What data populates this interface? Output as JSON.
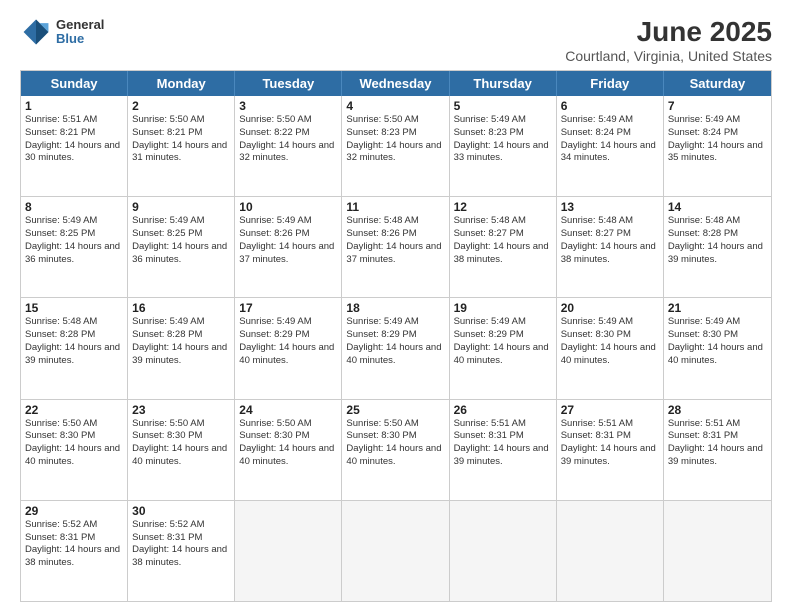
{
  "header": {
    "logo_general": "General",
    "logo_blue": "Blue",
    "title": "June 2025",
    "subtitle": "Courtland, Virginia, United States"
  },
  "weekdays": [
    "Sunday",
    "Monday",
    "Tuesday",
    "Wednesday",
    "Thursday",
    "Friday",
    "Saturday"
  ],
  "rows": [
    [
      {
        "day": "1",
        "sunrise": "Sunrise: 5:51 AM",
        "sunset": "Sunset: 8:21 PM",
        "daylight": "Daylight: 14 hours and 30 minutes."
      },
      {
        "day": "2",
        "sunrise": "Sunrise: 5:50 AM",
        "sunset": "Sunset: 8:21 PM",
        "daylight": "Daylight: 14 hours and 31 minutes."
      },
      {
        "day": "3",
        "sunrise": "Sunrise: 5:50 AM",
        "sunset": "Sunset: 8:22 PM",
        "daylight": "Daylight: 14 hours and 32 minutes."
      },
      {
        "day": "4",
        "sunrise": "Sunrise: 5:50 AM",
        "sunset": "Sunset: 8:23 PM",
        "daylight": "Daylight: 14 hours and 32 minutes."
      },
      {
        "day": "5",
        "sunrise": "Sunrise: 5:49 AM",
        "sunset": "Sunset: 8:23 PM",
        "daylight": "Daylight: 14 hours and 33 minutes."
      },
      {
        "day": "6",
        "sunrise": "Sunrise: 5:49 AM",
        "sunset": "Sunset: 8:24 PM",
        "daylight": "Daylight: 14 hours and 34 minutes."
      },
      {
        "day": "7",
        "sunrise": "Sunrise: 5:49 AM",
        "sunset": "Sunset: 8:24 PM",
        "daylight": "Daylight: 14 hours and 35 minutes."
      }
    ],
    [
      {
        "day": "8",
        "sunrise": "Sunrise: 5:49 AM",
        "sunset": "Sunset: 8:25 PM",
        "daylight": "Daylight: 14 hours and 36 minutes."
      },
      {
        "day": "9",
        "sunrise": "Sunrise: 5:49 AM",
        "sunset": "Sunset: 8:25 PM",
        "daylight": "Daylight: 14 hours and 36 minutes."
      },
      {
        "day": "10",
        "sunrise": "Sunrise: 5:49 AM",
        "sunset": "Sunset: 8:26 PM",
        "daylight": "Daylight: 14 hours and 37 minutes."
      },
      {
        "day": "11",
        "sunrise": "Sunrise: 5:48 AM",
        "sunset": "Sunset: 8:26 PM",
        "daylight": "Daylight: 14 hours and 37 minutes."
      },
      {
        "day": "12",
        "sunrise": "Sunrise: 5:48 AM",
        "sunset": "Sunset: 8:27 PM",
        "daylight": "Daylight: 14 hours and 38 minutes."
      },
      {
        "day": "13",
        "sunrise": "Sunrise: 5:48 AM",
        "sunset": "Sunset: 8:27 PM",
        "daylight": "Daylight: 14 hours and 38 minutes."
      },
      {
        "day": "14",
        "sunrise": "Sunrise: 5:48 AM",
        "sunset": "Sunset: 8:28 PM",
        "daylight": "Daylight: 14 hours and 39 minutes."
      }
    ],
    [
      {
        "day": "15",
        "sunrise": "Sunrise: 5:48 AM",
        "sunset": "Sunset: 8:28 PM",
        "daylight": "Daylight: 14 hours and 39 minutes."
      },
      {
        "day": "16",
        "sunrise": "Sunrise: 5:49 AM",
        "sunset": "Sunset: 8:28 PM",
        "daylight": "Daylight: 14 hours and 39 minutes."
      },
      {
        "day": "17",
        "sunrise": "Sunrise: 5:49 AM",
        "sunset": "Sunset: 8:29 PM",
        "daylight": "Daylight: 14 hours and 40 minutes."
      },
      {
        "day": "18",
        "sunrise": "Sunrise: 5:49 AM",
        "sunset": "Sunset: 8:29 PM",
        "daylight": "Daylight: 14 hours and 40 minutes."
      },
      {
        "day": "19",
        "sunrise": "Sunrise: 5:49 AM",
        "sunset": "Sunset: 8:29 PM",
        "daylight": "Daylight: 14 hours and 40 minutes."
      },
      {
        "day": "20",
        "sunrise": "Sunrise: 5:49 AM",
        "sunset": "Sunset: 8:30 PM",
        "daylight": "Daylight: 14 hours and 40 minutes."
      },
      {
        "day": "21",
        "sunrise": "Sunrise: 5:49 AM",
        "sunset": "Sunset: 8:30 PM",
        "daylight": "Daylight: 14 hours and 40 minutes."
      }
    ],
    [
      {
        "day": "22",
        "sunrise": "Sunrise: 5:50 AM",
        "sunset": "Sunset: 8:30 PM",
        "daylight": "Daylight: 14 hours and 40 minutes."
      },
      {
        "day": "23",
        "sunrise": "Sunrise: 5:50 AM",
        "sunset": "Sunset: 8:30 PM",
        "daylight": "Daylight: 14 hours and 40 minutes."
      },
      {
        "day": "24",
        "sunrise": "Sunrise: 5:50 AM",
        "sunset": "Sunset: 8:30 PM",
        "daylight": "Daylight: 14 hours and 40 minutes."
      },
      {
        "day": "25",
        "sunrise": "Sunrise: 5:50 AM",
        "sunset": "Sunset: 8:30 PM",
        "daylight": "Daylight: 14 hours and 40 minutes."
      },
      {
        "day": "26",
        "sunrise": "Sunrise: 5:51 AM",
        "sunset": "Sunset: 8:31 PM",
        "daylight": "Daylight: 14 hours and 39 minutes."
      },
      {
        "day": "27",
        "sunrise": "Sunrise: 5:51 AM",
        "sunset": "Sunset: 8:31 PM",
        "daylight": "Daylight: 14 hours and 39 minutes."
      },
      {
        "day": "28",
        "sunrise": "Sunrise: 5:51 AM",
        "sunset": "Sunset: 8:31 PM",
        "daylight": "Daylight: 14 hours and 39 minutes."
      }
    ],
    [
      {
        "day": "29",
        "sunrise": "Sunrise: 5:52 AM",
        "sunset": "Sunset: 8:31 PM",
        "daylight": "Daylight: 14 hours and 38 minutes."
      },
      {
        "day": "30",
        "sunrise": "Sunrise: 5:52 AM",
        "sunset": "Sunset: 8:31 PM",
        "daylight": "Daylight: 14 hours and 38 minutes."
      },
      {
        "day": "",
        "sunrise": "",
        "sunset": "",
        "daylight": ""
      },
      {
        "day": "",
        "sunrise": "",
        "sunset": "",
        "daylight": ""
      },
      {
        "day": "",
        "sunrise": "",
        "sunset": "",
        "daylight": ""
      },
      {
        "day": "",
        "sunrise": "",
        "sunset": "",
        "daylight": ""
      },
      {
        "day": "",
        "sunrise": "",
        "sunset": "",
        "daylight": ""
      }
    ]
  ]
}
